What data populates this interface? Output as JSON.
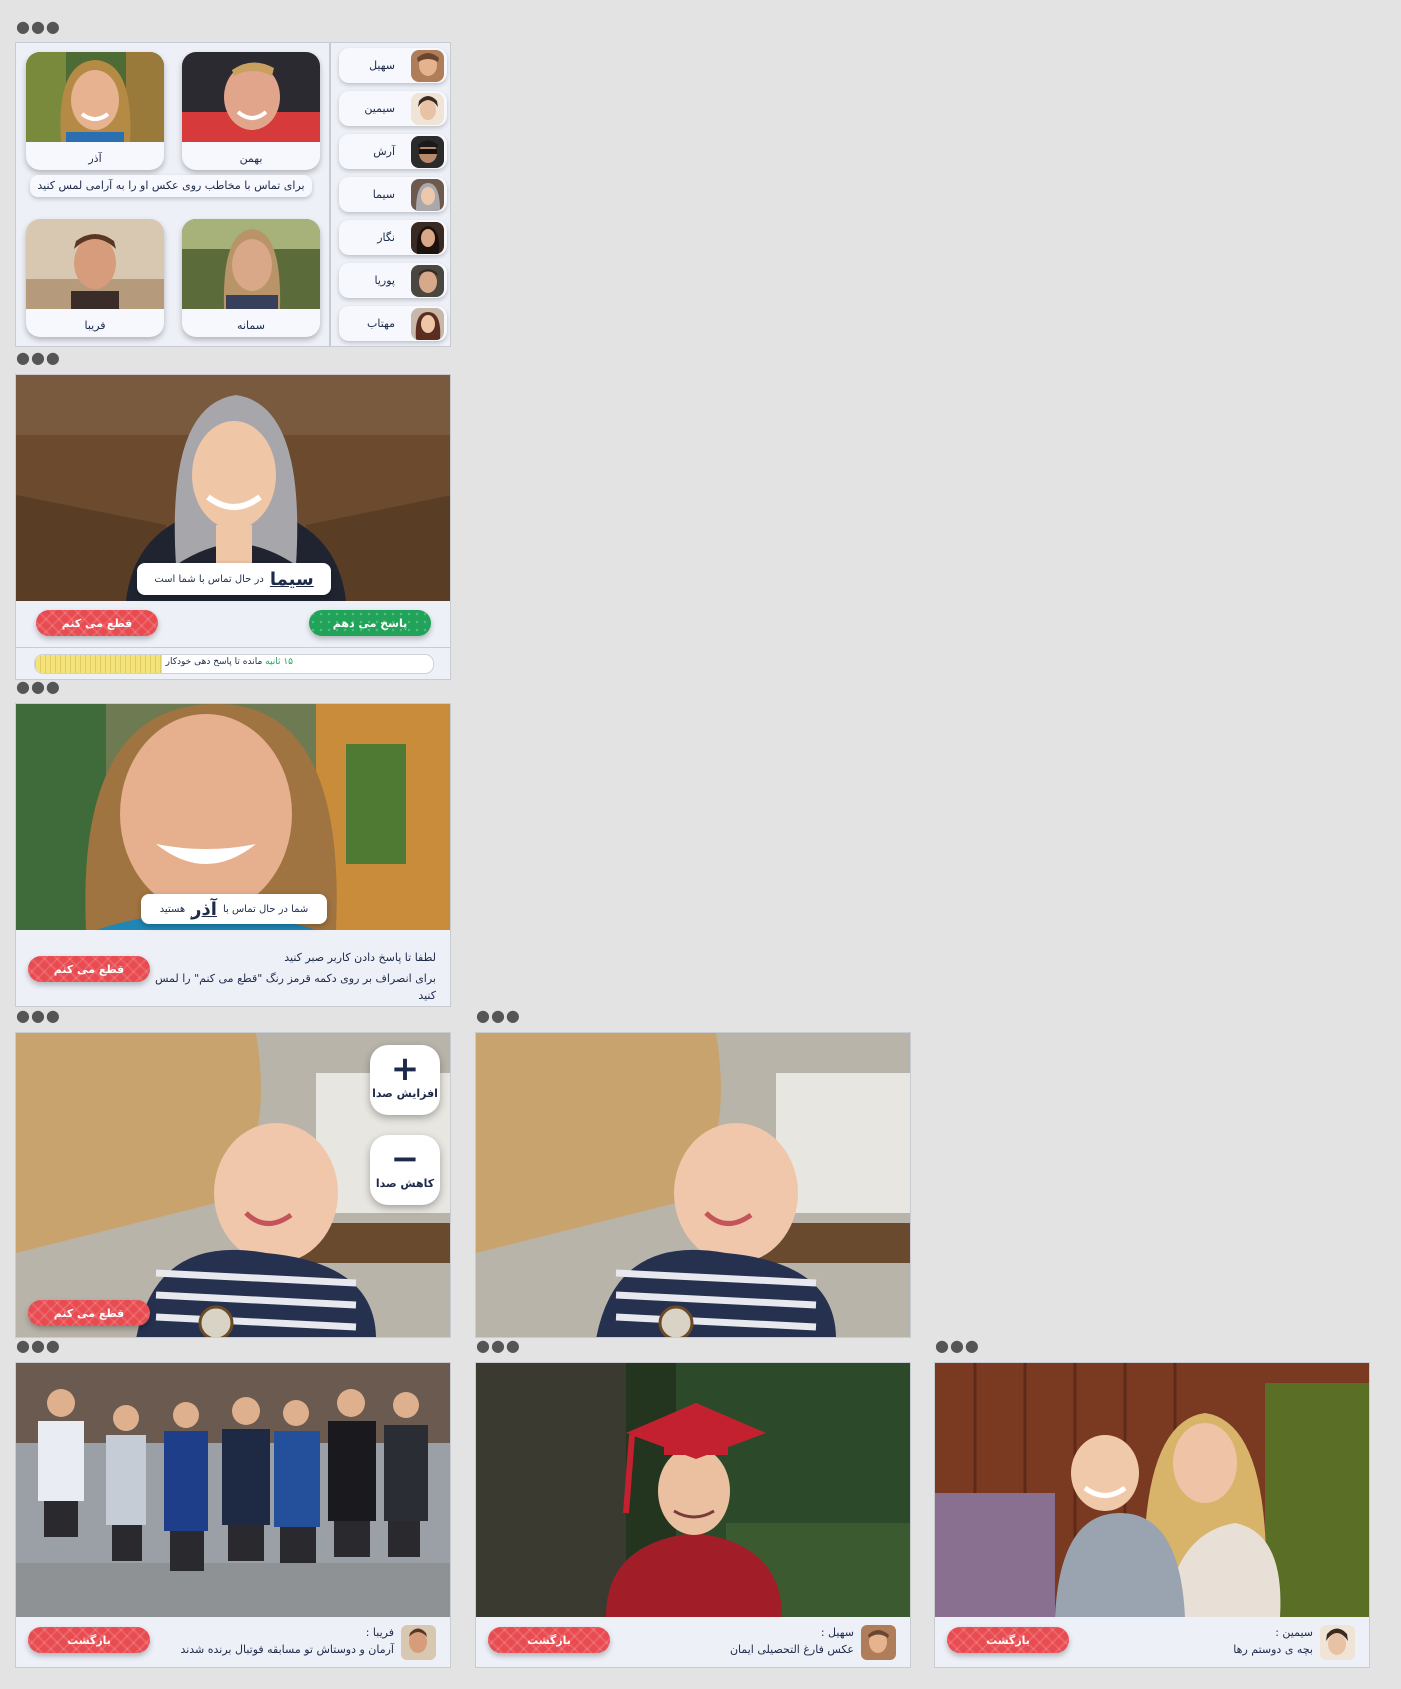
{
  "contacts_screen": {
    "sidebar": [
      {
        "name": "سهیل"
      },
      {
        "name": "سیمین"
      },
      {
        "name": "آرش"
      },
      {
        "name": "سیما"
      },
      {
        "name": "نگار"
      },
      {
        "name": "پوریا"
      },
      {
        "name": "مهتاب"
      }
    ],
    "cards_top": [
      {
        "name": "بهمن"
      },
      {
        "name": "آذر"
      }
    ],
    "hint": "برای تماس با مخاطب روی عکس او را به آرامی لمس کنید",
    "cards_bottom": [
      {
        "name": "سمانه"
      },
      {
        "name": "فریبا"
      }
    ]
  },
  "incoming_call": {
    "caller": "سیما",
    "message": "در حال تماس با شما است",
    "answer_label": "پاسخ می دهم",
    "reject_label": "قطع می کنم",
    "seconds": "۱۵ ثانیه",
    "countdown_text": "مانده تا پاسخ دهی خودکار",
    "countdown_remaining": 0.32
  },
  "outgoing_call": {
    "prefix": "شما در حال تماس با",
    "callee": "آذر",
    "suffix": "هستید",
    "line1": "لطفا تا پاسخ دادن کاربر صبر کنید",
    "line2": "برای انصراف بر روی دکمه قرمز رنگ \"قطع می کنم\" را لمس کنید",
    "reject_label": "قطع می کنم"
  },
  "in_call": {
    "volume_up_label": "افزایش صدا",
    "volume_down_label": "کاهش صدا",
    "reject_label": "قطع می کنم"
  },
  "shared_photos": [
    {
      "sender": "فریبا :",
      "caption": "آرمان و دوستاش تو مسابقه فوتبال برنده شدند",
      "back_label": "بازگشت"
    },
    {
      "sender": "سهیل :",
      "caption": "عکس فارغ التحصیلی ایمان",
      "back_label": "بازگشت"
    },
    {
      "sender": "سیمین :",
      "caption": "بچه ی دوستم رها",
      "back_label": "بازگشت"
    }
  ],
  "colors": {
    "red_button": "#e84b50",
    "green_button": "#21a35a",
    "panel_bg": "#eef0f8",
    "text_navy": "#1d2a4a",
    "countdown_bar": "#f4e27a"
  },
  "menu_icon": "more-horizontal-icon"
}
